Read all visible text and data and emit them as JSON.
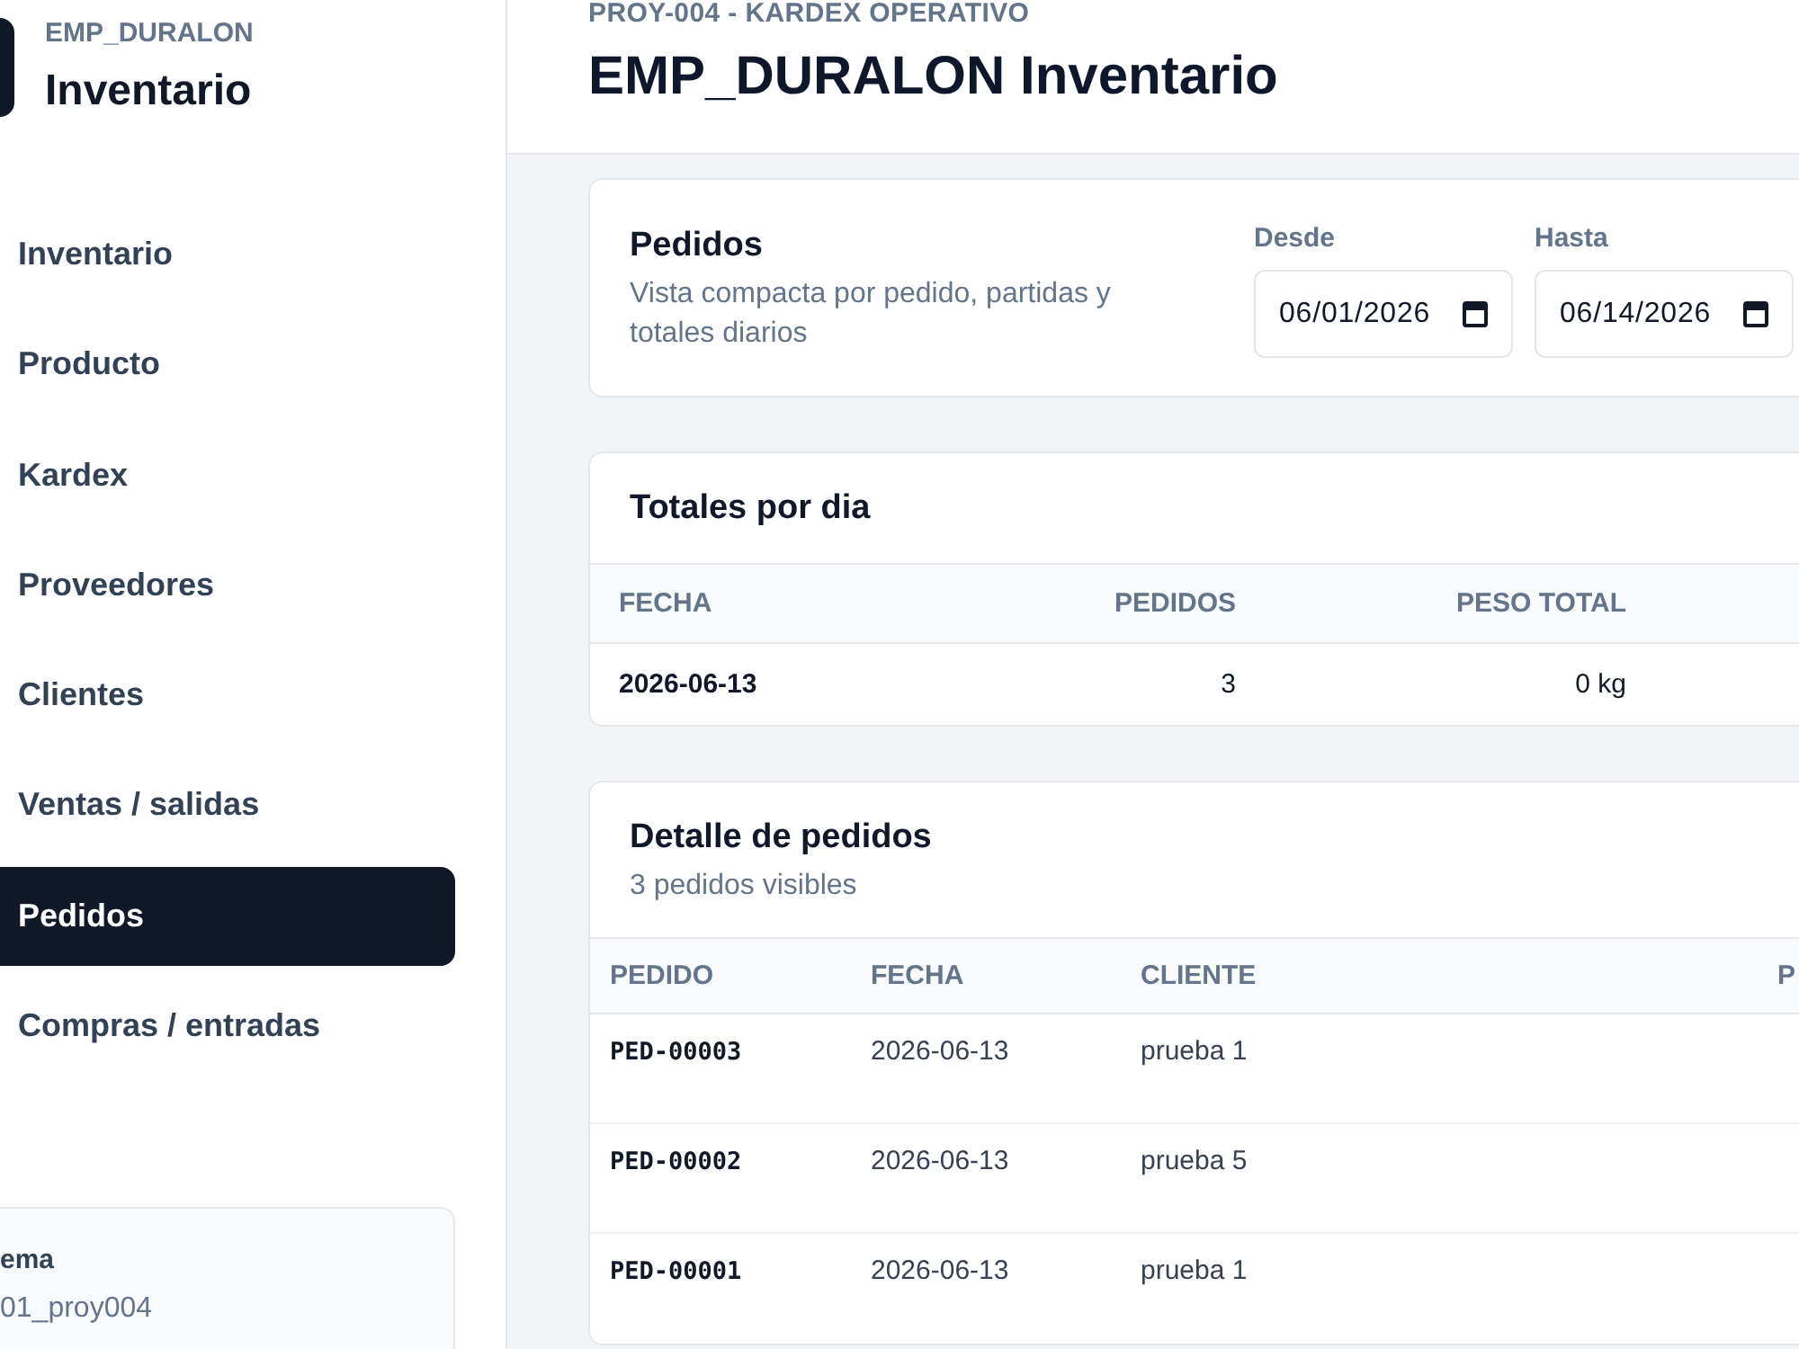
{
  "sidebar": {
    "brand": {
      "company": "EMP_DURALON",
      "title": "Inventario"
    },
    "nav": [
      {
        "label": "Inventario",
        "selected": false
      },
      {
        "label": "Producto",
        "selected": false
      },
      {
        "label": "Kardex",
        "selected": false
      },
      {
        "label": "Proveedores",
        "selected": false
      },
      {
        "label": "Clientes",
        "selected": false
      },
      {
        "label": "Ventas / salidas",
        "selected": false
      },
      {
        "label": "Pedidos",
        "selected": true
      },
      {
        "label": "Compras / entradas",
        "selected": false
      }
    ],
    "info_card": {
      "label": "ema",
      "value": "01_proy004"
    }
  },
  "header": {
    "eyebrow": "PROY-004 - KARDEX OPERATIVO",
    "title": "EMP_DURALON Inventario"
  },
  "filter_card": {
    "title": "Pedidos",
    "description": "Vista compacta por pedido, partidas y totales diarios",
    "fields": [
      {
        "label": "Desde",
        "value": "06/01/2026"
      },
      {
        "label": "Hasta",
        "value": "06/14/2026"
      }
    ]
  },
  "daily_totals": {
    "title": "Totales por dia",
    "columns": [
      "FECHA",
      "PEDIDOS",
      "PESO TOTAL"
    ],
    "rows": [
      [
        "2026-06-13",
        "3",
        "0 kg"
      ]
    ]
  },
  "orders": {
    "title": "Detalle de pedidos",
    "subtitle": "3 pedidos visibles",
    "columns": [
      "PEDIDO",
      "FECHA",
      "CLIENTE",
      "P"
    ],
    "rows": [
      [
        "PED-00003",
        "2026-06-13",
        "prueba 1"
      ],
      [
        "PED-00002",
        "2026-06-13",
        "prueba 5"
      ],
      [
        "PED-00001",
        "2026-06-13",
        "prueba 1"
      ]
    ]
  }
}
